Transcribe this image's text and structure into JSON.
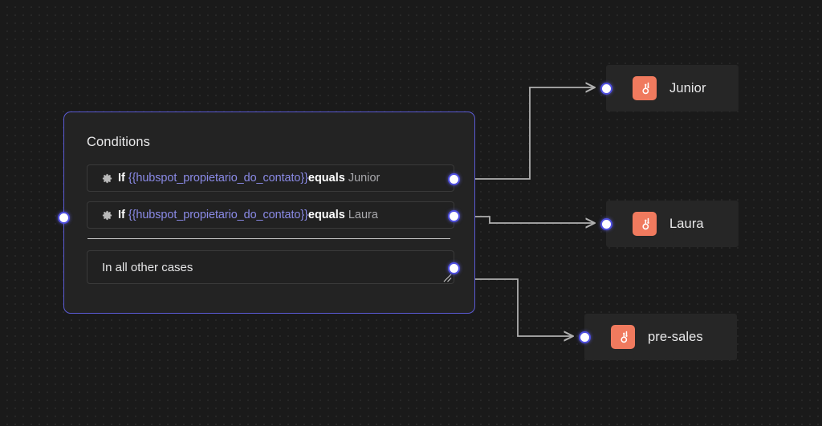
{
  "canvas": {
    "background_color": "#1a1a1a",
    "dot_color": "#272727",
    "accent_color": "#5b5bd6",
    "edge_color": "#b0b0b0"
  },
  "conditions_node": {
    "title": "Conditions",
    "border_color": "#5b5bd6",
    "background_color": "#232323",
    "input_handle_name": "target-handle",
    "rows": [
      {
        "icon": "gear-icon",
        "if_label": "If ",
        "variable": "{{hubspot_propietario_do_contato}}",
        "operator": "equals",
        "value": " Junior"
      },
      {
        "icon": "gear-icon",
        "if_label": "If ",
        "variable": "{{hubspot_propietario_do_contato}}",
        "operator": "equals",
        "value": " Laura"
      }
    ],
    "fallback_row": {
      "label": "In all other cases",
      "resize_handle": "resize-grip-icon"
    }
  },
  "target_nodes": [
    {
      "id": "junior",
      "label": "Junior",
      "icon": "hubspot-icon",
      "icon_color": "#f07a5e"
    },
    {
      "id": "laura",
      "label": "Laura",
      "icon": "hubspot-icon",
      "icon_color": "#f07a5e"
    },
    {
      "id": "pre-sales",
      "label": "pre-sales",
      "icon": "hubspot-icon",
      "icon_color": "#f07a5e"
    }
  ],
  "edges": [
    {
      "from": "condition-1",
      "to": "junior"
    },
    {
      "from": "condition-2",
      "to": "laura"
    },
    {
      "from": "fallback",
      "to": "pre-sales"
    }
  ]
}
